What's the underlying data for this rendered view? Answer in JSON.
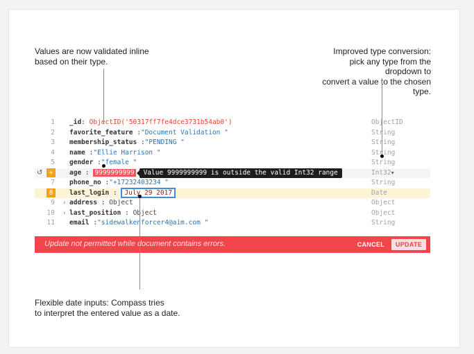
{
  "callouts": {
    "top_left": [
      "Values are now validated inline",
      "based on their type."
    ],
    "top_right": [
      "Improved type conversion:",
      "pick any type from the",
      "dropdown to",
      "convert a value to the chosen",
      "type."
    ],
    "bottom_left": [
      "Flexible date inputs: Compass tries",
      "to interpret the entered value as a date."
    ]
  },
  "document": {
    "rows": [
      {
        "line": "1",
        "key": "_id",
        "value": "ObjectID('50317ff7fe4dce3731b54ab0')",
        "type": "ObjectID"
      },
      {
        "line": "2",
        "key": "favorite_feature",
        "value": "\"Document Validation \"",
        "type": "String"
      },
      {
        "line": "3",
        "key": "membership_status",
        "value": "\"PENDING \"",
        "type": "String"
      },
      {
        "line": "4",
        "key": "name",
        "value": "\"Ellie Harrison \"",
        "type": "String"
      },
      {
        "line": "5",
        "key": "gender",
        "value": "\"female \"",
        "type": "String"
      },
      {
        "line": "6",
        "key": "age",
        "value": "9999999999",
        "type": "Int32",
        "tooltip": "Value 9999999999 is outside the valid Int32 range"
      },
      {
        "line": "7",
        "key": "phone_no",
        "value": "\"+17232403234 \"",
        "type": "String"
      },
      {
        "line": "8",
        "key": "last_login",
        "value": "July 29 2017",
        "type": "Date"
      },
      {
        "line": "9",
        "key": "address",
        "value": "Object",
        "type": "Object"
      },
      {
        "line": "10",
        "key": "last_position",
        "value": "Object",
        "type": "Object"
      },
      {
        "line": "11",
        "key": "email",
        "value": "\"sidewalkenforcer4@aim.com \"",
        "type": "String"
      }
    ],
    "separator": ":",
    "added_badge": "+",
    "revert_icon": "undo-icon",
    "expand_icon": "chevron-right-icon",
    "dropdown_icon": "caret-down-icon"
  },
  "error_bar": {
    "message": "Update not permitted while document contains errors.",
    "cancel_label": "CANCEL",
    "update_label": "UPDATE"
  },
  "colors": {
    "error_bar": "#f0454b",
    "error_value": "#f0545c",
    "edited_row": "#fdf3d7",
    "badge": "#f4a118",
    "string_value": "#2a73b8",
    "objectid_value": "#e3422b",
    "focus_border": "#3b8fd8"
  }
}
